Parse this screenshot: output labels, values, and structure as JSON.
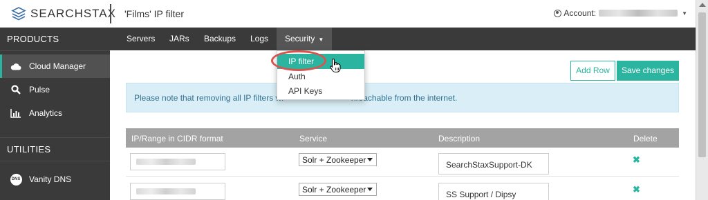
{
  "header": {
    "logo_text": "SEARCHSTAX",
    "page_title": "'Films' IP filter",
    "account_label": "Account:"
  },
  "sidebar": {
    "products_heading": "PRODUCTS",
    "products": [
      {
        "label": "Cloud Manager",
        "icon": "cloud-icon",
        "active": true
      },
      {
        "label": "Pulse",
        "icon": "search-icon",
        "active": false
      },
      {
        "label": "Analytics",
        "icon": "bar-chart-icon",
        "active": false
      }
    ],
    "utilities_heading": "UTILITIES",
    "utilities": [
      {
        "label": "Vanity DNS",
        "icon": "dns-icon",
        "icon_text": "DNS"
      }
    ]
  },
  "nav": {
    "items": [
      "Servers",
      "JARs",
      "Backups",
      "Logs",
      "Security"
    ]
  },
  "security_menu": {
    "items": [
      "IP filter",
      "Auth",
      "API Keys"
    ],
    "active_index": 0
  },
  "actions": {
    "add_row": "Add Row",
    "save_changes": "Save changes"
  },
  "notice": {
    "before": "Please note that removing all IP filters wi",
    "after": "nreachable from the internet."
  },
  "table": {
    "columns": [
      "IP/Range in CIDR format",
      "Service",
      "Description",
      "Delete"
    ],
    "rows": [
      {
        "service": "Solr + Zookeeper",
        "description": "SearchStaxSupport-DK"
      },
      {
        "service": "Solr + Zookeeper",
        "description": "SS Support / Dipsy"
      }
    ]
  },
  "colors": {
    "accent": "#2bb5a0",
    "dark": "#3a3a3a",
    "highlight": "#d9534f",
    "notice_bg": "#d9eef6"
  }
}
